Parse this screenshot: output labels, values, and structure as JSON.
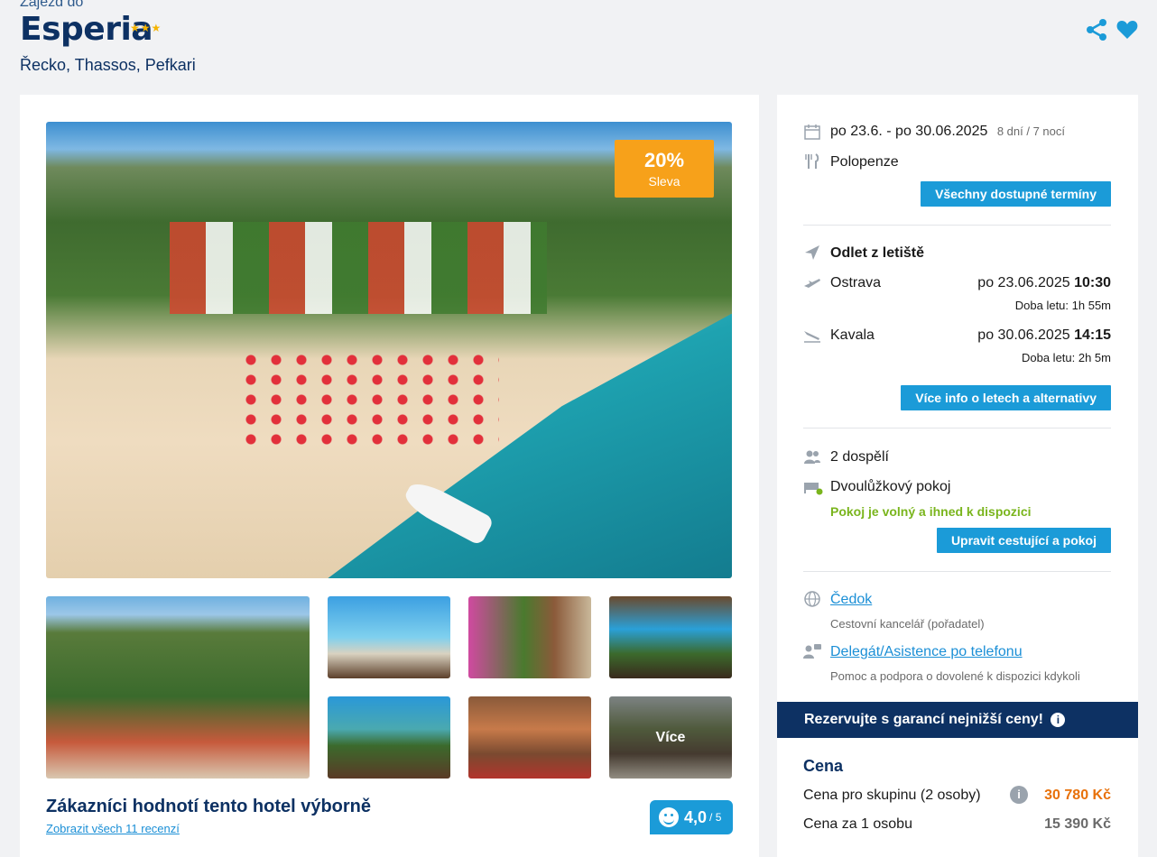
{
  "header": {
    "pre": "Zájezd do",
    "title": "Esperia",
    "stars": "★★★",
    "location": "Řecko, Thassos, Pefkari"
  },
  "gallery": {
    "discount_pct": "20%",
    "discount_label": "Sleva",
    "more_label": "Více"
  },
  "reviews": {
    "title": "Zákazníci hodnotí tento hotel výborně",
    "link": "Zobrazit všech 11 recenzí",
    "score": "4,0",
    "max": "/ 5"
  },
  "trip": {
    "dates": "po 23.6. - po 30.06.2025",
    "duration": "8 dní / 7 nocí",
    "board": "Polopenze",
    "all_dates_button": "Všechny dostupné termíny"
  },
  "flights": {
    "heading": "Odlet z letiště",
    "out": {
      "airport": "Ostrava",
      "date": "po 23.06.2025",
      "time": "10:30",
      "duration": "Doba letu: 1h 55m"
    },
    "back": {
      "airport": "Kavala",
      "date": "po 30.06.2025",
      "time": "14:15",
      "duration": "Doba letu: 2h 5m"
    },
    "more_button": "Více info o letech a alternativy"
  },
  "room": {
    "travelers": "2 dospělí",
    "type": "Dvoulůžkový pokoj",
    "availability": "Pokoj je volný a ihned k dispozici",
    "edit_button": "Upravit cestující a pokoj"
  },
  "agency": {
    "name": "Čedok",
    "desc": "Cestovní kancelář (pořadatel)",
    "support": "Delegát/Asistence po telefonu",
    "support_desc": "Pomoc a podpora o dovolené k dispozici kdykoli"
  },
  "price": {
    "guarantee": "Rezervujte s garancí nejnižší ceny!",
    "heading": "Cena",
    "group_label": "Cena pro skupinu (2 osoby)",
    "group_value": "30 780 Kč",
    "person_label": "Cena za 1 osobu",
    "person_value": "15 390 Kč"
  },
  "colors": {
    "accent": "#1b9bd8",
    "navy": "#0d3163",
    "orange": "#f7a11a",
    "green": "#7ab51d"
  }
}
